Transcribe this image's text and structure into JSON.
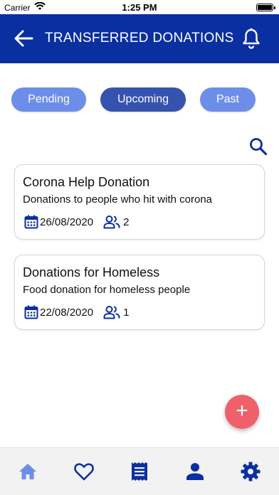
{
  "status_bar": {
    "carrier": "Carrier",
    "time": "1:25 PM"
  },
  "header": {
    "title": "TRANSFERRED DONATIONS"
  },
  "filters": [
    {
      "label": "Pending"
    },
    {
      "label": "Upcoming",
      "selected": true
    },
    {
      "label": "Past"
    }
  ],
  "donations": [
    {
      "title": "Corona Help Donation",
      "description": "Donations to people who hit with corona",
      "date": "26/08/2020",
      "people": "2"
    },
    {
      "title": "Donations for Homeless",
      "description": "Food donation for homeless people",
      "date": "22/08/2020",
      "people": "1"
    }
  ],
  "fab": {
    "label": "+"
  },
  "bottom_nav": [
    {
      "icon": "home-icon",
      "active": true
    },
    {
      "icon": "heart-icon"
    },
    {
      "icon": "receipt-icon"
    },
    {
      "icon": "person-icon"
    },
    {
      "icon": "gear-icon"
    }
  ],
  "colors": {
    "header": "#0a2fa0",
    "pill": "#6d8ee8",
    "pill_selected": "#3553ae",
    "fab": "#f0606b",
    "nav_icon": "#0a2fa0"
  }
}
